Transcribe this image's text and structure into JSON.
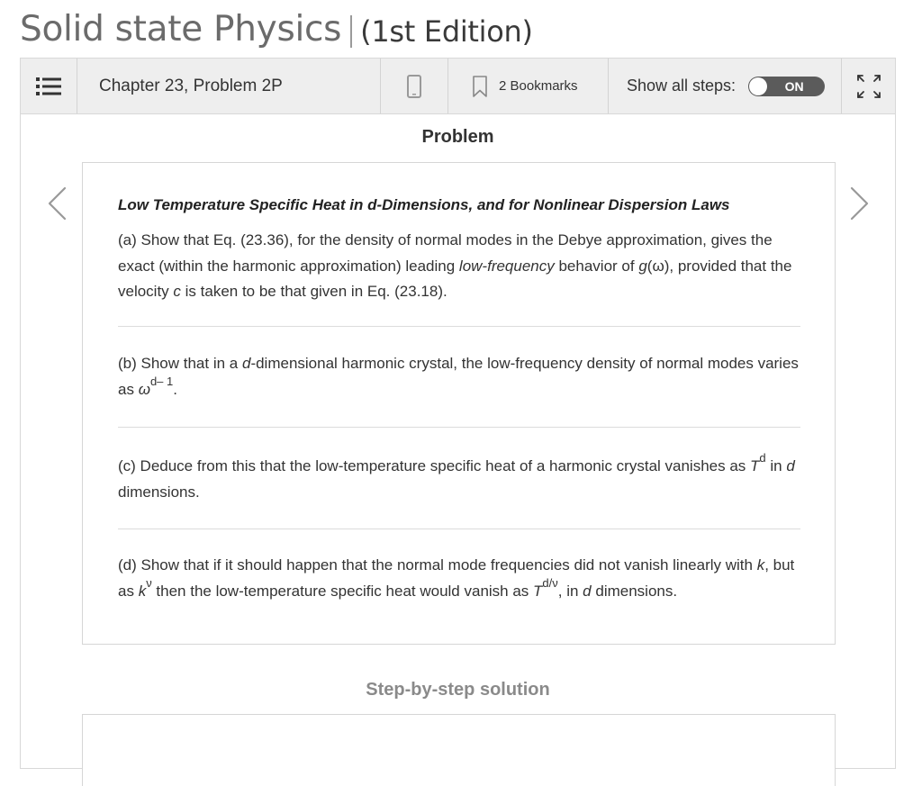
{
  "book": {
    "name": "Solid state Physics",
    "edition": "(1st Edition)"
  },
  "toolbar": {
    "chapter": "Chapter 23, Problem 2P",
    "bookmarks_label": "2 Bookmarks",
    "show_steps_label": "Show all steps:",
    "toggle_state": "ON",
    "icons": [
      "list-menu-icon",
      "mobile-phone-icon",
      "bookmark-icon",
      "expand-fullscreen-icon"
    ]
  },
  "problem": {
    "heading": "Problem",
    "title": "Low Temperature Specific Heat in d-Dimensions, and for Nonlinear Dispersion Laws",
    "a": {
      "t1": "(a) Show that Eq. (23.36), for the density of normal modes in the Debye approximation, gives the exact (within the harmonic approximation) leading ",
      "i1": "low-frequency",
      "t2": " behavior of ",
      "i2": "g",
      "t3": "(ω), provided that the velocity ",
      "i3": "c",
      "t4": " is taken to be that given in Eq. (23.18)."
    },
    "b": {
      "t1": "(b) Show that in a ",
      "i1": "d",
      "t2": "-dimensional harmonic crystal, the low-frequency density of normal modes varies as ",
      "i2": "ω",
      "sup": "d– 1",
      "t3": "."
    },
    "c": {
      "t1": "(c) Deduce from this that the low-temperature specific heat of a harmonic crystal vanishes as ",
      "i1": "T",
      "sup": "d",
      "t2": " in ",
      "i2": "d",
      "t3": " dimensions."
    },
    "d": {
      "t1": "(d) Show that if it should happen that the normal mode frequencies did not vanish linearly with ",
      "i1": "k",
      "t2": ", but as ",
      "i2": "k",
      "sup1": "ν",
      "t3": " then the low-temperature specific heat would vanish as ",
      "i3": "T",
      "sup2": "d/ν",
      "t4": ", in ",
      "i4": "d",
      "t5": " dimensions."
    }
  },
  "solution": {
    "heading": "Step-by-step solution"
  },
  "colors": {
    "toolbar_bg": "#eeeeee",
    "toggle_bg": "#5b5b5b",
    "title_gray": "#6b6b6b"
  }
}
